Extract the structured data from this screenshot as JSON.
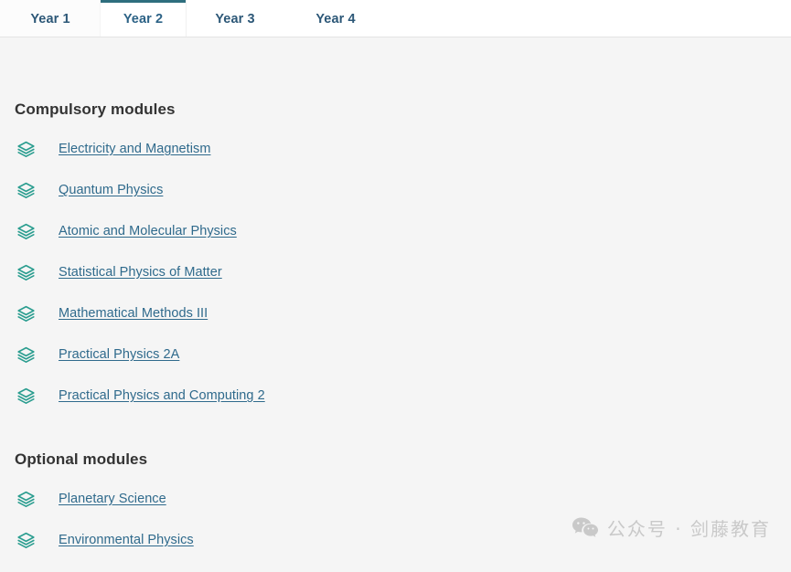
{
  "tabs": [
    {
      "label": "Year 1",
      "active": false
    },
    {
      "label": "Year 2",
      "active": true
    },
    {
      "label": "Year 3",
      "active": false
    },
    {
      "label": "Year 4",
      "active": false
    }
  ],
  "sections": {
    "compulsory": {
      "title": "Compulsory modules",
      "modules": [
        {
          "label": "Electricity and Magnetism",
          "icon": "layers-icon"
        },
        {
          "label": "Quantum Physics",
          "icon": "layers-icon"
        },
        {
          "label": "Atomic and Molecular Physics",
          "icon": "layers-icon"
        },
        {
          "label": "Statistical Physics of Matter",
          "icon": "layers-icon"
        },
        {
          "label": "Mathematical Methods III",
          "icon": "layers-icon"
        },
        {
          "label": "Practical Physics 2A",
          "icon": "layers-icon"
        },
        {
          "label": "Practical Physics and Computing 2",
          "icon": "layers-icon"
        }
      ]
    },
    "optional": {
      "title": "Optional modules",
      "modules": [
        {
          "label": "Planetary Science",
          "icon": "layers-icon"
        },
        {
          "label": "Environmental Physics",
          "icon": "layers-icon"
        }
      ]
    }
  },
  "watermark": {
    "icon": "wechat-icon",
    "text": "公众号 · 剑藤教育"
  },
  "colors": {
    "accent_teal": "#2e6e7e",
    "icon_teal": "#2a9d8f",
    "link_blue": "#2f6a8c",
    "tab_text": "#2c5777",
    "heading": "#333333",
    "panel_bg": "#f5f5f5",
    "tabbar_bg": "#ffffff",
    "watermark_gray": "#c9c9c9"
  }
}
